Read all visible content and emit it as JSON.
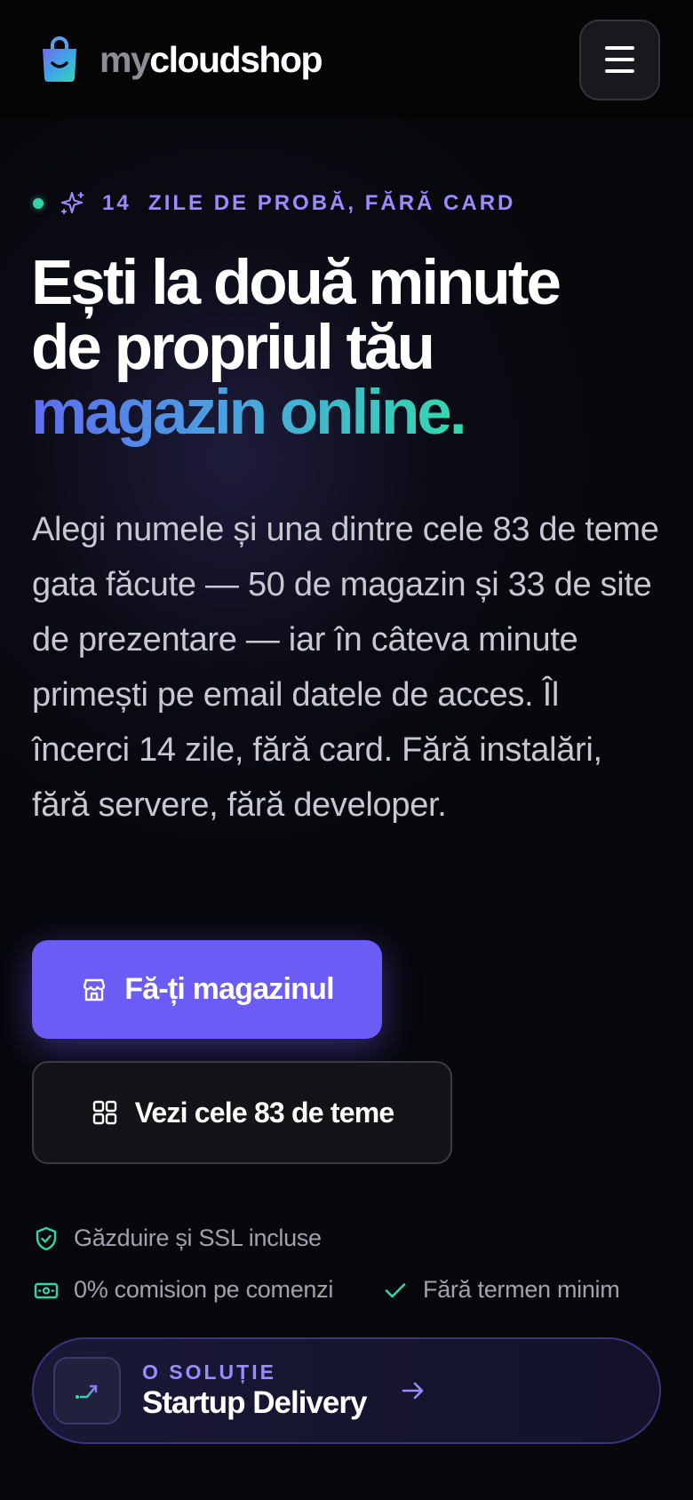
{
  "header": {
    "brand_my": "my",
    "brand_rest": "cloudshop",
    "logo_icon": "shopping-bag-smile-icon",
    "menu_icon": "hamburger-menu-icon"
  },
  "hero": {
    "badge_text": "14  ZILE DE PROBĂ, FĂRĂ CARD",
    "headline_line1": "Ești la două minute",
    "headline_line2": "de propriul tău",
    "headline_accent": "magazin online",
    "headline_dot": ".",
    "description": "Alegi numele și una dintre cele 83 de teme gata făcute — 50 de magazin și 33 de site de prezentare — iar în câteva minute primești pe email datele de acces. Îl încerci 14 zile, fără card. Fără instalări, fără servere, fără developer.",
    "primary_button": "Fă-ți magazinul",
    "secondary_button": "Vezi cele 83 de teme"
  },
  "features": [
    {
      "icon": "shield-check-icon",
      "label": "Găzduire și SSL incluse"
    },
    {
      "icon": "banknote-icon",
      "label": "0% comision pe comenzi"
    },
    {
      "icon": "check-icon",
      "label": "Fără termen minim"
    }
  ],
  "solution": {
    "kicker": "O SOLUȚIE",
    "title": "Startup Delivery",
    "icon": "trend-arrow-icon",
    "arrow_icon": "arrow-right-icon"
  },
  "colors": {
    "accent_purple": "#6a5cf5",
    "accent_lavender": "#9a8cff",
    "accent_teal": "#35d6b0",
    "background": "#07070c"
  }
}
